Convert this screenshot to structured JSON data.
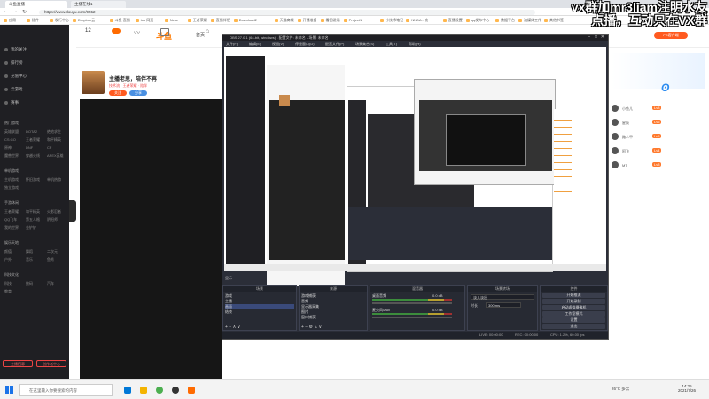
{
  "browser": {
    "tabs": [
      "斗鱼直播",
      "主播在线1",
      "ins社区",
      "主播在线15…"
    ],
    "url": "https://www.douyu.com/9552",
    "bookmarks": [
      "应用",
      "插件",
      "发行中心",
      "Dropbox云",
      "斗鱼·直播",
      "tos·网页",
      "Nesc",
      "王者荣耀",
      "直播伴侣",
      "Download2",
      "天猫商城",
      "开播准备",
      "看图说话",
      "Project1",
      "小技术笔记",
      "NNDA - 流",
      "直播设置",
      "qq发布中心",
      "数据平台",
      "流媒体工作",
      "其他书签"
    ]
  },
  "watermark": {
    "line1": "vx群加mr3liam注明水友",
    "line2": "点播，互动只在VX群"
  },
  "sidebar": {
    "items": [
      "我的关注",
      "排行榜",
      "充值中心",
      "云游戏",
      "赛事"
    ],
    "sections": [
      {
        "title": "热门游戏",
        "items": [
          "英雄联盟",
          "DOTA2",
          "绝地求生",
          "CS:GO",
          "王者荣耀",
          "和平精英",
          "原神",
          "DNF",
          "CF",
          "魔兽世界",
          "穿越火线",
          "APEX英雄"
        ]
      },
      {
        "title": "单机游戏",
        "items": [
          "主机游戏",
          "怀旧游戏",
          "单机热游",
          "独立游戏"
        ]
      },
      {
        "title": "手游休闲",
        "items": [
          "王者荣耀",
          "和平精英",
          "火影忍者",
          "QQ飞车",
          "第五人格",
          "阴阳师",
          "我的世界",
          "金铲铲"
        ]
      },
      {
        "title": "娱乐天地",
        "items": [
          "颜值",
          "舞蹈",
          "二次元",
          "户外",
          "音乐",
          "鱼秀"
        ]
      },
      {
        "title": "科技文化",
        "items": [
          "科技",
          "数码",
          "汽车",
          "教育"
        ]
      }
    ],
    "bottom_buttons": [
      "主播招募",
      "创作者中心"
    ]
  },
  "topnav": {
    "logo": "斗鱼",
    "items": [
      "首页",
      "直播",
      "分类",
      "游戏",
      "鱼吧"
    ],
    "count": "12",
    "right_badges": [
      "PC客户端",
      "下载",
      "登录"
    ]
  },
  "room": {
    "title": "主播老思，陪伴不再",
    "tags": [
      "技术流",
      "王者荣耀",
      "陪伴",
      "高端局"
    ],
    "actions": [
      "关注",
      "分享"
    ]
  },
  "right_panel": {
    "tabs": [
      "贵宾",
      "粉丝团"
    ],
    "users": [
      {
        "name": "小鱼儿",
        "level": "Lv8"
      },
      {
        "name": "星辰",
        "level": "Lv6"
      },
      {
        "name": "路人甲",
        "level": "Lv5"
      },
      {
        "name": "阿飞",
        "level": "Lv4"
      },
      {
        "name": "MT",
        "level": "Lv3"
      }
    ]
  },
  "obs": {
    "title": "OBS 27.0.1 (64-bit, windows) - 配置文件: 未命名 - 场景: 未命名",
    "menu": [
      "文件(F)",
      "编辑(E)",
      "视图(V)",
      "停靠窗口(D)",
      "配置文件(P)",
      "场景集合(S)",
      "工具(T)",
      "帮助(H)"
    ],
    "status_left": [
      "显示",
      "设置"
    ],
    "docks": {
      "scenes": {
        "title": "场景",
        "items": [
          "游戏",
          "主播",
          "画面",
          "结束"
        ]
      },
      "sources": {
        "title": "来源",
        "items": [
          "游戏捕获",
          "音频",
          "显示器采集",
          "图片",
          "窗口捕获"
        ]
      },
      "mixer": {
        "title": "混音器",
        "tracks": [
          {
            "name": "桌面音频",
            "db": "0.0 dB"
          },
          {
            "name": "麦克风/Aux",
            "db": "0.0 dB"
          }
        ]
      },
      "transitions": {
        "title": "场景转场",
        "type": "淡入淡出",
        "duration_label": "时长",
        "duration": "300 ms"
      },
      "controls": {
        "title": "控件",
        "buttons": [
          "开始推流",
          "开始录制",
          "启动虚拟摄像机",
          "工作室模式",
          "设置",
          "退出"
        ]
      }
    },
    "statusbar": [
      "LIVE: 00:00:00",
      "REC: 00:00:00",
      "CPU: 1.2%, 60.00 fps"
    ]
  },
  "taskbar": {
    "search": "在这里输入你要搜索的内容",
    "weather": "26°C 多云",
    "time": "14:25",
    "date": "2021/7/26"
  }
}
